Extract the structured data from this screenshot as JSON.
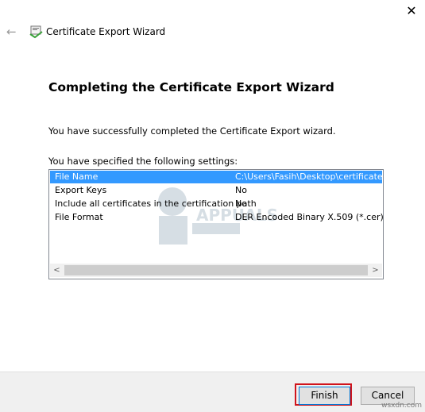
{
  "window": {
    "title": "Certificate Export Wizard",
    "close_symbol": "✕",
    "back_symbol": "←"
  },
  "wizard": {
    "heading": "Completing the Certificate Export Wizard",
    "success_message": "You have successfully completed the Certificate Export wizard.",
    "settings_caption": "You have specified the following settings:",
    "settings": [
      {
        "name": "File Name",
        "value": "C:\\Users\\Fasih\\Desktop\\certificate.cer",
        "selected": true
      },
      {
        "name": "Export Keys",
        "value": "No",
        "selected": false
      },
      {
        "name": "Include all certificates in the certification path",
        "value": "No",
        "selected": false
      },
      {
        "name": "File Format",
        "value": "DER Encoded Binary X.509 (*.cer)",
        "selected": false
      }
    ],
    "watermark_text": "APPUALS"
  },
  "scrollbar": {
    "left_arrow": "<",
    "right_arrow": ">"
  },
  "buttons": {
    "finish": "Finish",
    "cancel": "Cancel"
  },
  "site_mark": "wsxdn.com",
  "colors": {
    "selection": "#3399ff",
    "highlight_outline": "#d0141c",
    "footer": "#f0f0f0"
  }
}
